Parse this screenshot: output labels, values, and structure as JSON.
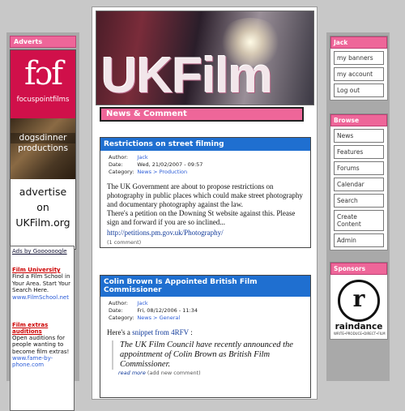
{
  "adverts": {
    "title": "Adverts",
    "focuspoint_logo": "fɔf",
    "focuspoint_name": "focuspointfilms",
    "dogsdinner_line1": "dogsdinner",
    "dogsdinner_line2": "productions",
    "advertise_line1": "advertise",
    "advertise_line2": "on",
    "advertise_line3": "UKFilm.org"
  },
  "google_ads": {
    "by": "Ads by Goooooogle",
    "items": [
      {
        "title": "Film University",
        "desc": "Find a Film School in Your Area. Start Your Search Here.",
        "url": "www.FilmSchool.net"
      },
      {
        "title": "Film extras auditions",
        "desc": "Open auditions for people wanting to become film extras!",
        "url": "www.fame-by-phone.com"
      }
    ]
  },
  "banner": {
    "title": "UKFilm"
  },
  "section": {
    "title": "News & Comment"
  },
  "posts": [
    {
      "title": "Restrictions on street filming",
      "author_label": "Author:",
      "author": "Jack",
      "date_label": "Date:",
      "date": "Wed, 21/02/2007 - 09:57",
      "category_label": "Category:",
      "category": "News > Production",
      "body": "The UK Government are about to propose restrictions on photography in public places which could make street photography and documentary photography against the law.",
      "body2": "There's a petition on the Downing St website against this. Please sign and forward if you are so inclined...",
      "link": "http://petitions.pm.gov.uk/Photography/",
      "comments": "(1 comment)"
    },
    {
      "title": "Colin Brown Is Appointed British Film Commissioner",
      "author_label": "Author:",
      "author": "Jack",
      "date_label": "Date:",
      "date": "Fri, 08/12/2006 - 11:34",
      "category_label": "Category:",
      "category": "News > General",
      "intro_before": "Here's a ",
      "intro_link": "snippet from 4RFV",
      "intro_after": " :",
      "quote": "The UK Film Council have recently announced the appointment of Colin Brown as British Film Commissioner.",
      "read_more": "read more",
      "add_comment": "(add new comment)"
    }
  ],
  "user": {
    "title": "Jack",
    "items": [
      "my banners",
      "my account",
      "Log out"
    ]
  },
  "browse": {
    "title": "Browse",
    "items": [
      "News",
      "Features",
      "Forums",
      "Calendar",
      "Search",
      "Create Content",
      "Admin"
    ]
  },
  "sponsors": {
    "title": "Sponsors",
    "logo_letter": "r",
    "name": "raindance",
    "tagline": "WRITE•PRODUCE•DIRECT•FILM"
  },
  "colors": {
    "accent_pink": "#ee6699",
    "post_blue": "#1f6fd0",
    "ad_red": "#d0104a"
  }
}
